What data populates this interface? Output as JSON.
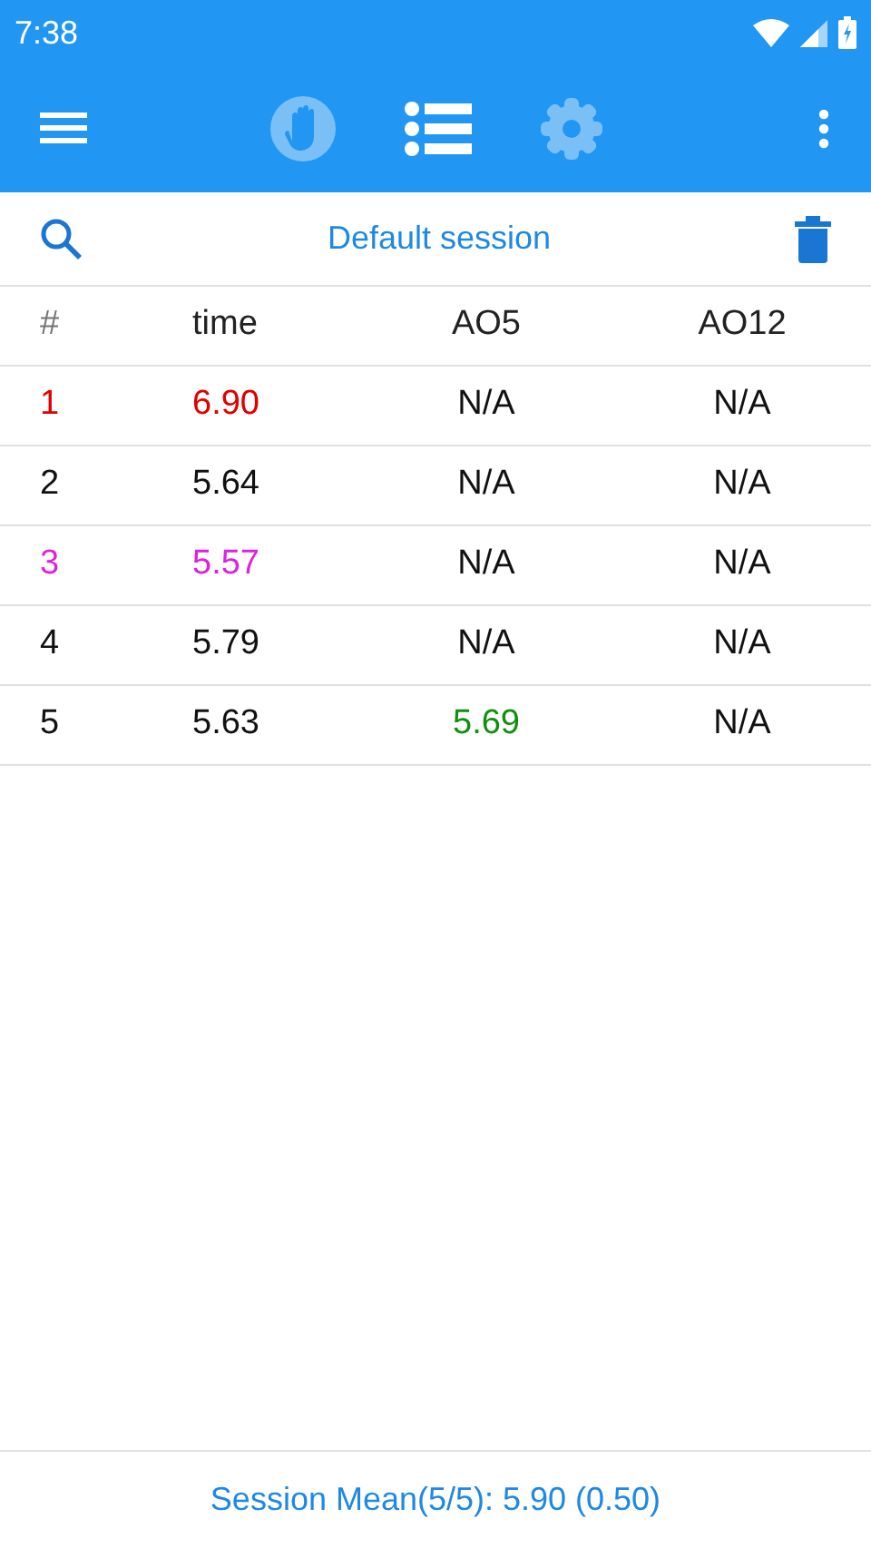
{
  "status_bar": {
    "time": "7:38"
  },
  "tabs": [
    {
      "kind": "timer",
      "selected": false
    },
    {
      "kind": "list",
      "selected": true
    },
    {
      "kind": "settings",
      "selected": false
    }
  ],
  "session": {
    "title": "Default session"
  },
  "table": {
    "columns": [
      "#",
      "time",
      "AO5",
      "AO12"
    ],
    "rows": [
      {
        "cells": [
          {
            "text": "1",
            "color": "#e00000"
          },
          {
            "text": "6.90",
            "color": "#e00000"
          },
          {
            "text": "N/A",
            "color": "#111111"
          },
          {
            "text": "N/A",
            "color": "#111111"
          }
        ]
      },
      {
        "cells": [
          {
            "text": "2",
            "color": "#111111"
          },
          {
            "text": "5.64",
            "color": "#111111"
          },
          {
            "text": "N/A",
            "color": "#111111"
          },
          {
            "text": "N/A",
            "color": "#111111"
          }
        ]
      },
      {
        "cells": [
          {
            "text": "3",
            "color": "#e020e0"
          },
          {
            "text": "5.57",
            "color": "#e020e0"
          },
          {
            "text": "N/A",
            "color": "#111111"
          },
          {
            "text": "N/A",
            "color": "#111111"
          }
        ]
      },
      {
        "cells": [
          {
            "text": "4",
            "color": "#111111"
          },
          {
            "text": "5.79",
            "color": "#111111"
          },
          {
            "text": "N/A",
            "color": "#111111"
          },
          {
            "text": "N/A",
            "color": "#111111"
          }
        ]
      },
      {
        "cells": [
          {
            "text": "5",
            "color": "#111111"
          },
          {
            "text": "5.63",
            "color": "#111111"
          },
          {
            "text": "5.69",
            "color": "#109010"
          },
          {
            "text": "N/A",
            "color": "#111111"
          }
        ]
      }
    ]
  },
  "footer": {
    "summary": "Session Mean(5/5): 5.90 (0.50)"
  }
}
